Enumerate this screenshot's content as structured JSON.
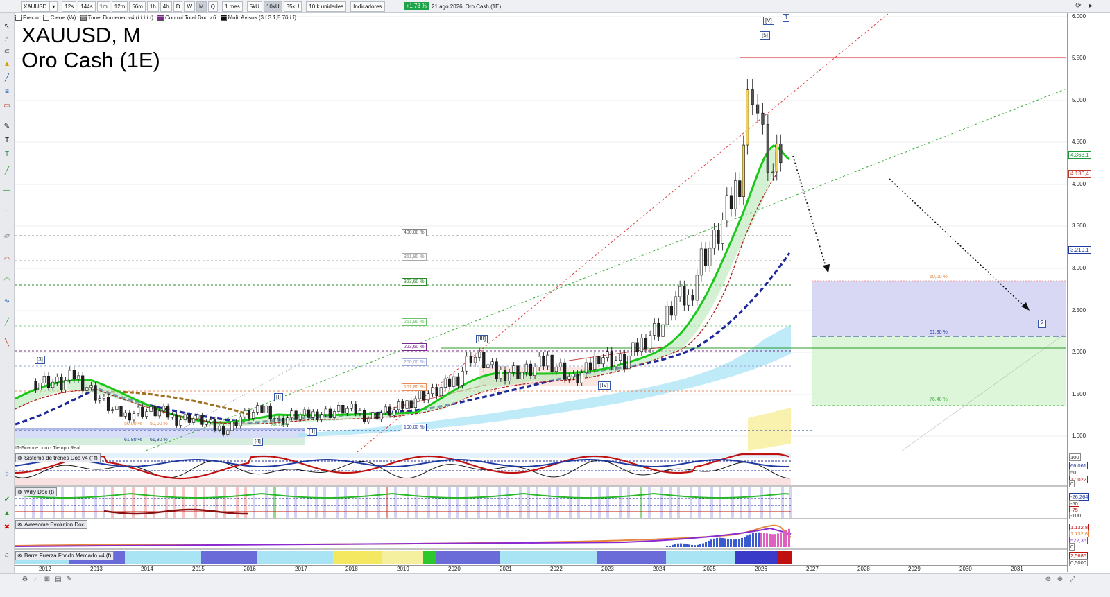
{
  "toolbar": {
    "symbol": "XAUUSD",
    "timeframes": [
      "12s",
      "144s",
      "1m",
      "12m",
      "56m",
      "1h",
      "4h",
      "D",
      "W",
      "M",
      "Q"
    ],
    "active_timeframe": "M",
    "period": "1 mes",
    "units": [
      "5kU",
      "10kU",
      "35kU"
    ],
    "active_unit": "10kU",
    "units_select": "10 k unidades",
    "indicators_label": "Indicadores",
    "change_badge": "+1,78 %",
    "date": "21 ago 2026",
    "instrument": "Oro Cash (1E)",
    "colors": {
      "badge": "#1ea34a"
    }
  },
  "legend": [
    {
      "label": "Precio",
      "color": "#ffffff"
    },
    {
      "label": "Cierre (W)",
      "color": "#ffffff"
    },
    {
      "label": "Tunel Domenec v4 (t t t t t)",
      "color": "#888888"
    },
    {
      "label": "Control Total Doc v.6",
      "color": "#7a2a8a"
    },
    {
      "label": "Multi Avisos (3 f 3 1,5 70 f f)",
      "color": "#111111"
    }
  ],
  "chart_title": {
    "line1": "XAUUSD, M",
    "line2": "Oro Cash (1E)"
  },
  "price_axis": {
    "labels": [
      "6.000",
      "5.500",
      "5.000",
      "4.500",
      "4.000",
      "3.500",
      "3.000",
      "2.500",
      "2.000",
      "1.500",
      "1.000"
    ],
    "tags": [
      {
        "text": "4.363,1",
        "color": "#1a9a3a"
      },
      {
        "text": "4.136,4",
        "color": "#c0392b"
      },
      {
        "text": "3.219,1",
        "color": "#1f3aa0"
      }
    ]
  },
  "fibo_levels": [
    {
      "label": "400,00 %",
      "color": "#888888"
    },
    {
      "label": "361,80 %",
      "color": "#aaaaaa"
    },
    {
      "label": "323,60 %",
      "color": "#2a8a2a"
    },
    {
      "label": "261,80 %",
      "color": "#6ac26a"
    },
    {
      "label": "223,60 %",
      "color": "#7a2a8a"
    },
    {
      "label": "200,00 %",
      "color": "#9aa8d8"
    },
    {
      "label": "161,80 %",
      "color": "#e88a5a"
    },
    {
      "label": "100,00 %",
      "color": "#1f3aa0"
    }
  ],
  "projection_labels": [
    {
      "label": "50,00 %",
      "color": "#e8843a"
    },
    {
      "label": "61,80 %",
      "color": "#1f3aa0"
    },
    {
      "label": "76,40 %",
      "color": "#3aaa3a"
    }
  ],
  "left_zone_labels": [
    "50,00 %",
    "50,00 %",
    "61,80 %",
    "61,80 %",
    "88,20 %"
  ],
  "wave_labels": [
    "[3]",
    "[4]",
    "[I]",
    "[II]",
    "[III]",
    "[IV]",
    "[5]",
    "[V]",
    "1",
    "2"
  ],
  "source_text": "IT-Finance.com - Tiempo Real",
  "panes": [
    {
      "name": "Sistema de trenes Doc v4 (f f)",
      "values": [
        "100",
        "66,061",
        "50",
        "17,022",
        "0"
      ]
    },
    {
      "name": "Willy Doc (t)",
      "values": [
        "-26,264",
        "-50",
        "-75",
        "-100"
      ]
    },
    {
      "name": "Awesome Evolution Doc",
      "values": [
        "1.132,8",
        "1.132,8",
        "522,36",
        "0"
      ]
    },
    {
      "name": "Barra Fuerza Fondo Mercado v4 (f)",
      "values": [
        "2,5686",
        "0,5000"
      ]
    }
  ],
  "x_axis": [
    "2012",
    "2013",
    "2014",
    "2015",
    "2016",
    "2017",
    "2018",
    "2019",
    "2020",
    "2021",
    "2022",
    "2023",
    "2024",
    "2025",
    "2026",
    "2027",
    "2028",
    "2029",
    "2030",
    "2031"
  ],
  "chart_data": {
    "type": "candlestick",
    "x_unit": "year (monthly bars)",
    "ylim": [
      750,
      6050
    ],
    "y_ticks": [
      1000,
      1500,
      2000,
      2500,
      3000,
      3500,
      4000,
      4500,
      5000,
      5500,
      6000
    ],
    "monthly_close": [
      [
        2012.0,
        1650
      ],
      [
        2012.25,
        1660
      ],
      [
        2012.5,
        1610
      ],
      [
        2012.75,
        1720
      ],
      [
        2013.0,
        1600
      ],
      [
        2013.25,
        1450
      ],
      [
        2013.5,
        1300
      ],
      [
        2013.75,
        1250
      ],
      [
        2014.0,
        1300
      ],
      [
        2014.25,
        1290
      ],
      [
        2014.5,
        1280
      ],
      [
        2014.75,
        1200
      ],
      [
        2015.0,
        1220
      ],
      [
        2015.25,
        1180
      ],
      [
        2015.5,
        1100
      ],
      [
        2015.75,
        1080
      ],
      [
        2016.0,
        1230
      ],
      [
        2016.25,
        1270
      ],
      [
        2016.5,
        1330
      ],
      [
        2016.75,
        1170
      ],
      [
        2017.0,
        1240
      ],
      [
        2017.25,
        1240
      ],
      [
        2017.5,
        1270
      ],
      [
        2017.75,
        1280
      ],
      [
        2018.0,
        1320
      ],
      [
        2018.25,
        1300
      ],
      [
        2018.5,
        1220
      ],
      [
        2018.75,
        1280
      ],
      [
        2019.0,
        1300
      ],
      [
        2019.25,
        1390
      ],
      [
        2019.5,
        1500
      ],
      [
        2019.75,
        1510
      ],
      [
        2020.0,
        1590
      ],
      [
        2020.25,
        1710
      ],
      [
        2020.5,
        1970
      ],
      [
        2020.75,
        1880
      ],
      [
        2021.0,
        1730
      ],
      [
        2021.25,
        1780
      ],
      [
        2021.5,
        1760
      ],
      [
        2021.75,
        1800
      ],
      [
        2022.0,
        1920
      ],
      [
        2022.25,
        1810
      ],
      [
        2022.5,
        1660
      ],
      [
        2022.75,
        1770
      ],
      [
        2023.0,
        1980
      ],
      [
        2023.25,
        1920
      ],
      [
        2023.5,
        1870
      ],
      [
        2023.75,
        2060
      ],
      [
        2024.0,
        2230
      ],
      [
        2024.25,
        2330
      ],
      [
        2024.5,
        2630
      ],
      [
        2024.75,
        2620
      ],
      [
        2025.0,
        3120
      ],
      [
        2025.25,
        3300
      ],
      [
        2025.5,
        3650
      ],
      [
        2025.75,
        4100
      ],
      [
        2025.9,
        4950
      ],
      [
        2026.0,
        5200
      ],
      [
        2026.2,
        4500
      ],
      [
        2026.4,
        4100
      ],
      [
        2026.55,
        4363
      ]
    ],
    "resistance_level": 5500,
    "projection_zones": [
      {
        "name": "50,00 %",
        "from": 2850,
        "to": 2200
      },
      {
        "name": "61,80 %",
        "from": 2200,
        "to": 1380
      }
    ]
  }
}
